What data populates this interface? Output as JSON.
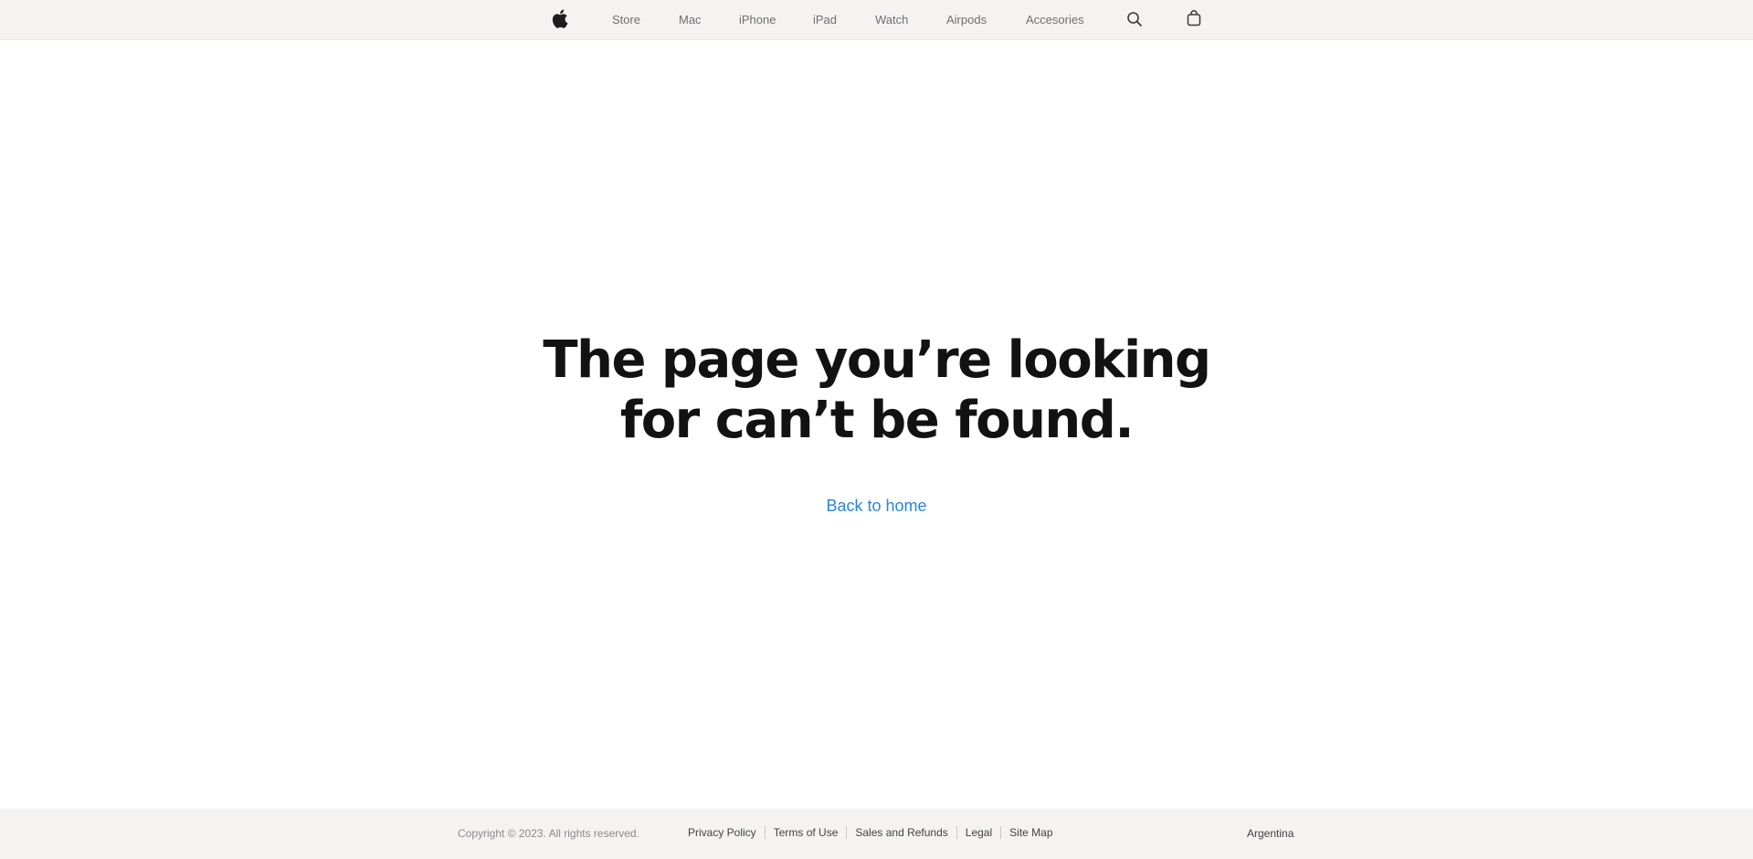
{
  "nav": {
    "items": [
      {
        "label": "Store"
      },
      {
        "label": "Mac"
      },
      {
        "label": "iPhone"
      },
      {
        "label": "iPad"
      },
      {
        "label": "Watch"
      },
      {
        "label": "Airpods"
      },
      {
        "label": "Accesories"
      }
    ],
    "icons": {
      "logo": "apple-logo-icon",
      "search": "search-icon",
      "bag": "shopping-bag-icon"
    }
  },
  "main": {
    "headline_line1": "The page you’re looking",
    "headline_line2": "for can’t be found.",
    "back_link": "Back to home"
  },
  "footer": {
    "copyright": "Copyright © 2023. All rights reserved.",
    "links": [
      {
        "label": "Privacy Policy"
      },
      {
        "label": "Terms of Use"
      },
      {
        "label": "Sales and Refunds"
      },
      {
        "label": "Legal"
      },
      {
        "label": "Site Map"
      }
    ],
    "region": "Argentina"
  },
  "colors": {
    "nav_background": "#f5f3f2",
    "footer_background": "#f5f3f2",
    "headline": "#121212",
    "link": "#2a86d9",
    "nav_text": "#6e6e73"
  }
}
